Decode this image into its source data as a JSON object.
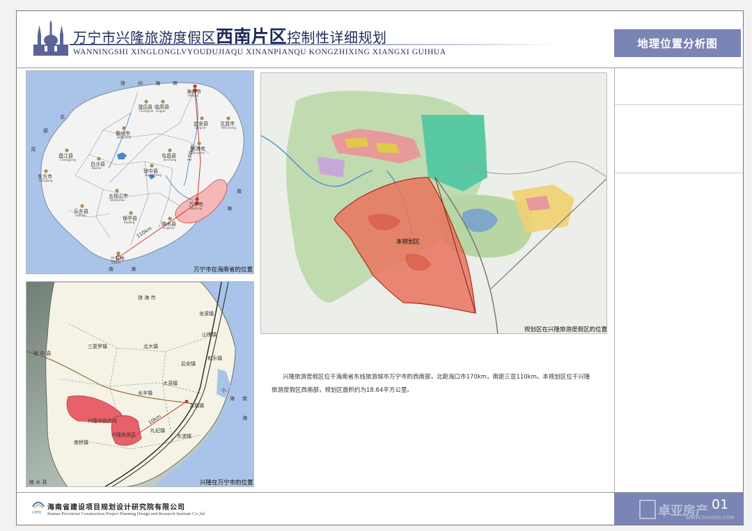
{
  "header": {
    "title_part1": "万宁市兴隆旅游度假区",
    "title_part2": "西南片区",
    "title_part3": "控制性详细规划",
    "title_en": "WANNINGSHI XINGLONGLVYOUDUJIAQU XINANPIANQU KONGZHIXING XIANGXI GUIHUA",
    "sheet_title": "地理位置分析图"
  },
  "map1": {
    "caption": "万宁市在海南省的位置",
    "sea_labels": [
      "琼",
      "州",
      "海",
      "峡",
      "北",
      "部",
      "湾",
      "南",
      "海",
      "南",
      "海"
    ],
    "cities": [
      {
        "name": "海口市",
        "en": "HAIKOU"
      },
      {
        "name": "澄迈县",
        "en": "Chengmai"
      },
      {
        "name": "临高县",
        "en": "Lingao"
      },
      {
        "name": "定安县",
        "en": "Ding'an"
      },
      {
        "name": "文昌市",
        "en": "Wenchang"
      },
      {
        "name": "儋州市",
        "en": "DANZHOU"
      },
      {
        "name": "屯昌县",
        "en": "Tunchang"
      },
      {
        "name": "琼海市",
        "en": "Qionghai"
      },
      {
        "name": "昌江县",
        "en": "Changjiang"
      },
      {
        "name": "白沙县",
        "en": "Baisha"
      },
      {
        "name": "琼中县",
        "en": "Qiongzhong"
      },
      {
        "name": "东方市",
        "en": "Dongfang"
      },
      {
        "name": "五指山市",
        "en": "Wuzhishan"
      },
      {
        "name": "万宁市",
        "en": "Wanning"
      },
      {
        "name": "乐东县",
        "en": "Ledong"
      },
      {
        "name": "保亭县",
        "en": "Baoting"
      },
      {
        "name": "陵水县",
        "en": "Lingshui"
      },
      {
        "name": "三亚市",
        "en": "SANYA"
      }
    ],
    "distance_north": "170km",
    "distance_south": "110km"
  },
  "map2": {
    "caption": "兴隆在万宁市的位置",
    "labels": [
      "琼 海 市",
      "龙滚镇",
      "山根镇",
      "三更罗镇",
      "北大镇",
      "和乐镇",
      "后安镇",
      "琼 中 县",
      "大茂镇",
      "长丰镇",
      "小",
      "海",
      "万城镇",
      "兴隆华侨农场",
      "兴隆旅游区",
      "礼纪镇",
      "东澳镇",
      "南桥镇",
      "陵 水 县",
      "南",
      "海"
    ],
    "distance": "10km"
  },
  "map3": {
    "caption": "规划区在兴隆旅游度假区的位置",
    "area_label": "本规划区"
  },
  "description": "兴隆旅游度假区位于海南省东线旅游城市万宁市的西南部，北距海口市170km，南距三亚110km。本规划区位于兴隆旅游度假区西南部，规划区面积约为18.64平方公里。",
  "footer": {
    "org_cn": "海南省建设项目规划设计研究院有限公司",
    "org_en": "Hainan Provincial Construction Project Planning Design and Research Institute Co.,ltd",
    "logo_text": "CPPD",
    "page": "01",
    "watermark": "卓亚房产",
    "watermark_url": "WWW.ZHUOYA.COM"
  },
  "colors": {
    "header_box": "#7b85b5",
    "sea": "#a9c4e8",
    "land": "#f2f2f2",
    "highlight": "#f5b8b8",
    "plan_area": "#e9735e"
  }
}
